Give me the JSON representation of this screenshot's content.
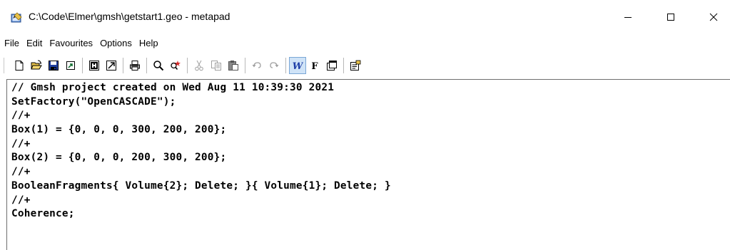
{
  "window": {
    "title": "C:\\Code\\Elmer\\gmsh\\getstart1.geo - metapad"
  },
  "menu": {
    "items": [
      "File",
      "Edit",
      "Favourites",
      "Options",
      "Help"
    ]
  },
  "toolbar": {
    "buttons": [
      "new-icon",
      "open-icon",
      "save-icon",
      "save-as-icon",
      "launch-viewer-icon",
      "launch-secondary-viewer-icon",
      "print-icon",
      "find-icon",
      "replace-icon",
      "cut-icon",
      "copy-icon",
      "paste-icon",
      "undo-icon",
      "redo-icon",
      "word-wrap-icon",
      "font-icon",
      "always-on-top-icon",
      "properties-icon"
    ]
  },
  "editor": {
    "lines": [
      "// Gmsh project created on Wed Aug 11 10:39:30 2021",
      "SetFactory(\"OpenCASCADE\");",
      "//+",
      "Box(1) = {0, 0, 0, 300, 200, 200};",
      "//+",
      "Box(2) = {0, 0, 0, 200, 300, 200};",
      "//+",
      "BooleanFragments{ Volume{2}; Delete; }{ Volume{1}; Delete; }",
      "//+",
      "Coherence;"
    ]
  }
}
